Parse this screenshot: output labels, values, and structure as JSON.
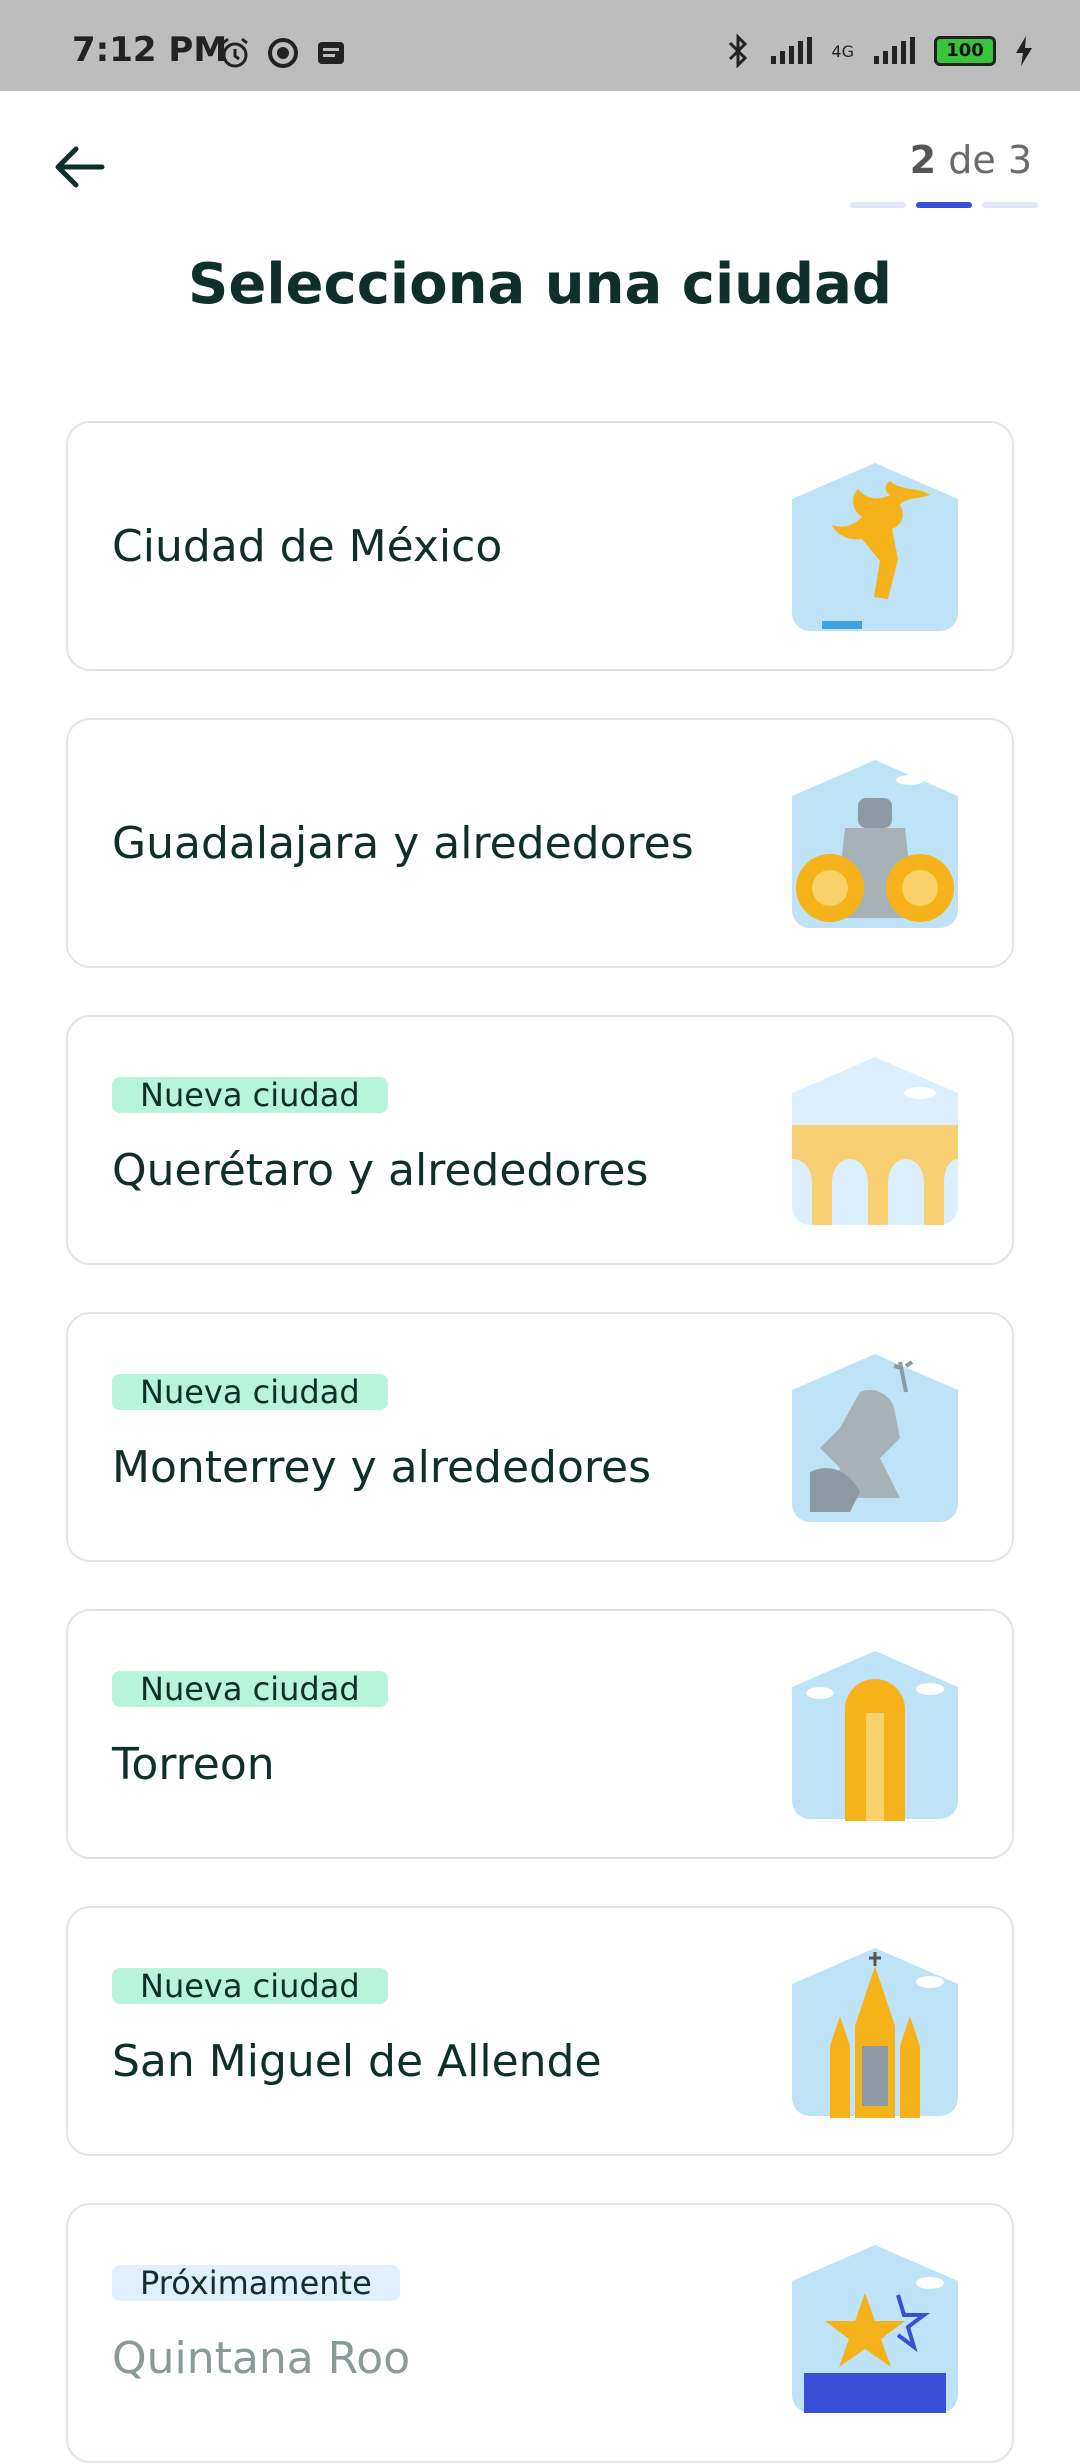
{
  "status_bar": {
    "time": "7:12 PM",
    "battery": "100",
    "network": "4G"
  },
  "header": {
    "current_step": "2",
    "step_separator": "de",
    "total_steps": "3"
  },
  "page": {
    "title": "Selecciona una ciudad"
  },
  "cities": [
    {
      "name": "Ciudad de México",
      "badge": ""
    },
    {
      "name": "Guadalajara y alrededores",
      "badge": ""
    },
    {
      "name": "Querétaro y alrededores",
      "badge": "Nueva ciudad"
    },
    {
      "name": "Monterrey y alrededores",
      "badge": "Nueva ciudad"
    },
    {
      "name": "Torreon",
      "badge": "Nueva ciudad"
    },
    {
      "name": "San Miguel de Allende",
      "badge": "Nueva ciudad"
    },
    {
      "name": "Quintana Roo",
      "badge": "Próximamente"
    }
  ],
  "colors": {
    "accent": "#3a4fd8",
    "text": "#0f2f2a",
    "badge_new": "#b8f3dc",
    "badge_soon": "#dfeffd",
    "disabled_text": "#8a9a98"
  }
}
